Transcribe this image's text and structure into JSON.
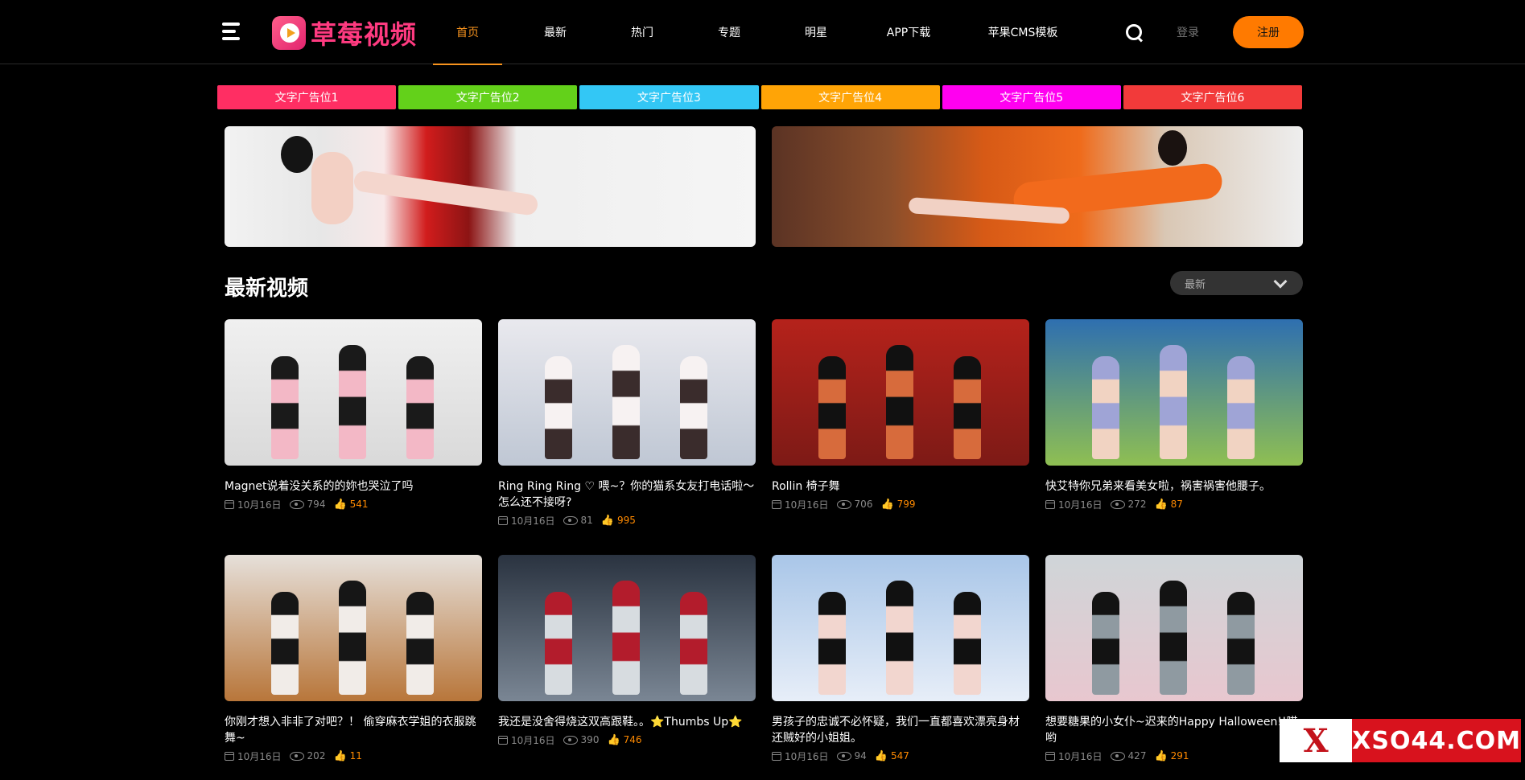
{
  "header": {
    "logo_text": "草莓视频",
    "nav": [
      "首页",
      "最新",
      "热门",
      "专题",
      "明星",
      "APP下载",
      "苹果CMS模板"
    ],
    "login_label": "登录",
    "register_label": "注册"
  },
  "text_ads": [
    {
      "label": "文字广告位1",
      "color": "#ff2e63"
    },
    {
      "label": "文字广告位2",
      "color": "#63d11a"
    },
    {
      "label": "文字广告位3",
      "color": "#33c7f5"
    },
    {
      "label": "文字广告位4",
      "color": "#ffa406"
    },
    {
      "label": "文字广告位5",
      "color": "#ff00f0"
    },
    {
      "label": "文字广告位6",
      "color": "#f23a3a"
    }
  ],
  "section": {
    "title": "最新视频",
    "sort_selected": "最新"
  },
  "videos": [
    {
      "title": "Magnet说着没关系的的妳也哭泣了吗",
      "date": "10月16日",
      "views": "794",
      "likes": "541",
      "palette": [
        "#f0f0f0",
        "#d9d9d9",
        "#1a1a1a",
        "#f3b8c6"
      ]
    },
    {
      "title": "Ring Ring Ring ♡ 喂~？你的猫系女友打电话啦～怎么还不接呀?",
      "date": "10月16日",
      "views": "81",
      "likes": "995",
      "palette": [
        "#e9e9ee",
        "#bfc7d4",
        "#f7f2f2",
        "#3a2c2c"
      ]
    },
    {
      "title": "Rollin 椅子舞",
      "date": "10月16日",
      "views": "706",
      "likes": "799",
      "palette": [
        "#b5221b",
        "#7d1a16",
        "#111111",
        "#d76b3c"
      ]
    },
    {
      "title": "快艾特你兄弟来看美女啦，祸害祸害他腰子。",
      "date": "10月16日",
      "views": "272",
      "likes": "87",
      "palette": [
        "#2e6fb0",
        "#8fbf52",
        "#9fa4d6",
        "#f1d3c2"
      ]
    },
    {
      "title": "你刚才想入非非了对吧？！ 偷穿麻衣学姐的衣服跳舞~",
      "date": "10月16日",
      "views": "202",
      "likes": "11",
      "palette": [
        "#e6e0da",
        "#b8763a",
        "#161616",
        "#f1ece8"
      ]
    },
    {
      "title": "我还是没舍得烧这双高跟鞋。。⭐Thumbs Up⭐",
      "date": "10月16日",
      "views": "390",
      "likes": "746",
      "palette": [
        "#2a3340",
        "#7a8694",
        "#b31c2c",
        "#d7dce0"
      ]
    },
    {
      "title": "男孩子的忠诚不必怀疑，我们一直都喜欢漂亮身材还贼好的小姐姐。",
      "date": "10月16日",
      "views": "94",
      "likes": "547",
      "palette": [
        "#a9c6e8",
        "#e7eef8",
        "#111111",
        "#f2d6cf"
      ]
    },
    {
      "title": "想要糖果的小女仆~迟来的Happy Halloween!!喵哟",
      "date": "10月16日",
      "views": "427",
      "likes": "291",
      "palette": [
        "#cfd5d8",
        "#e8c7cf",
        "#131313",
        "#8f9aa1"
      ]
    }
  ],
  "watermark": {
    "text": "XSO44.COM",
    "mark": "X"
  }
}
